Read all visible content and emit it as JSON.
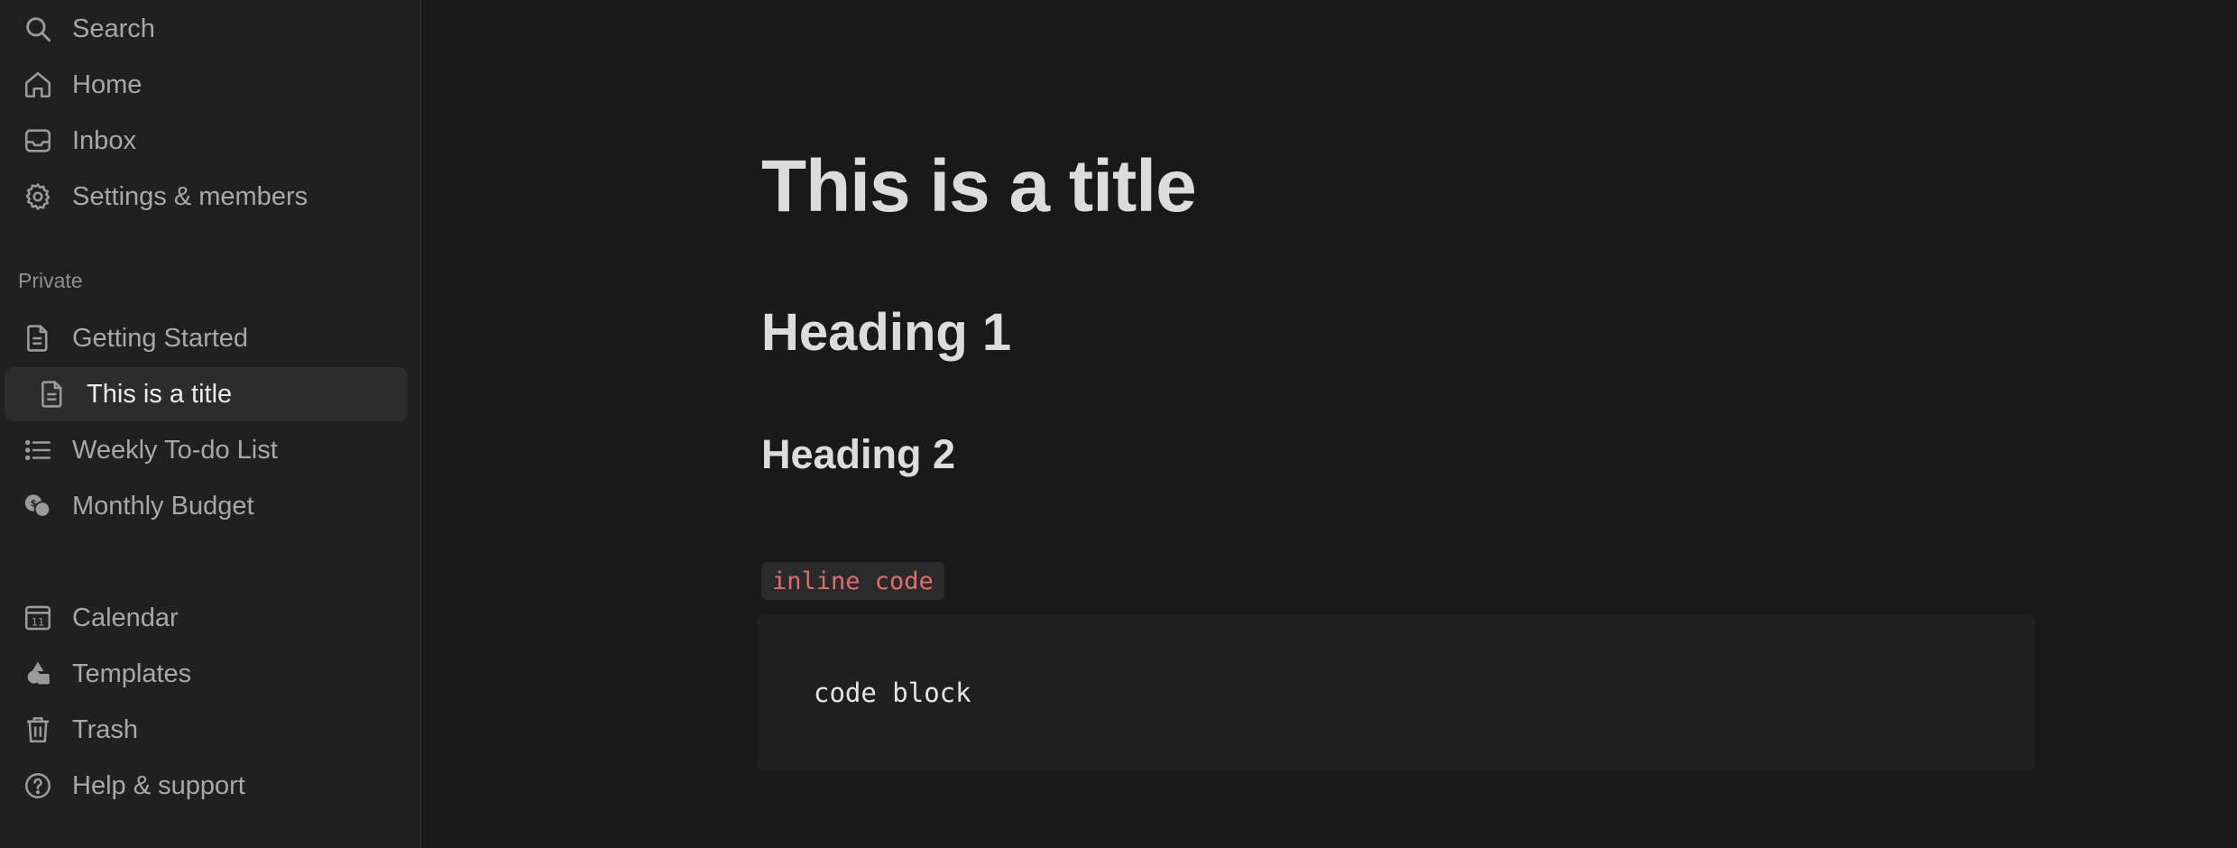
{
  "sidebar": {
    "top_items": [
      {
        "label": "Search",
        "icon": "search-icon"
      },
      {
        "label": "Home",
        "icon": "home-icon"
      },
      {
        "label": "Inbox",
        "icon": "inbox-icon"
      },
      {
        "label": "Settings & members",
        "icon": "gear-icon"
      }
    ],
    "section_label": "Private",
    "pages": [
      {
        "label": "Getting Started",
        "icon": "document-icon"
      },
      {
        "label": "This is a title",
        "icon": "document-icon",
        "active": true
      },
      {
        "label": "Weekly To-do List",
        "icon": "list-icon"
      },
      {
        "label": "Monthly Budget",
        "icon": "coins-icon"
      }
    ],
    "bottom_items": [
      {
        "label": "Calendar",
        "icon": "calendar-icon"
      },
      {
        "label": "Templates",
        "icon": "shapes-icon"
      },
      {
        "label": "Trash",
        "icon": "trash-icon"
      },
      {
        "label": "Help & support",
        "icon": "help-icon"
      }
    ]
  },
  "content": {
    "title": "This is a title",
    "heading1": "Heading 1",
    "heading2": "Heading 2",
    "inline_code": "inline code",
    "code_block": "code block"
  },
  "colors": {
    "background": "#191919",
    "sidebar": "#202020",
    "text": "#dcdcdc",
    "inline_code": "#e06c6c"
  }
}
